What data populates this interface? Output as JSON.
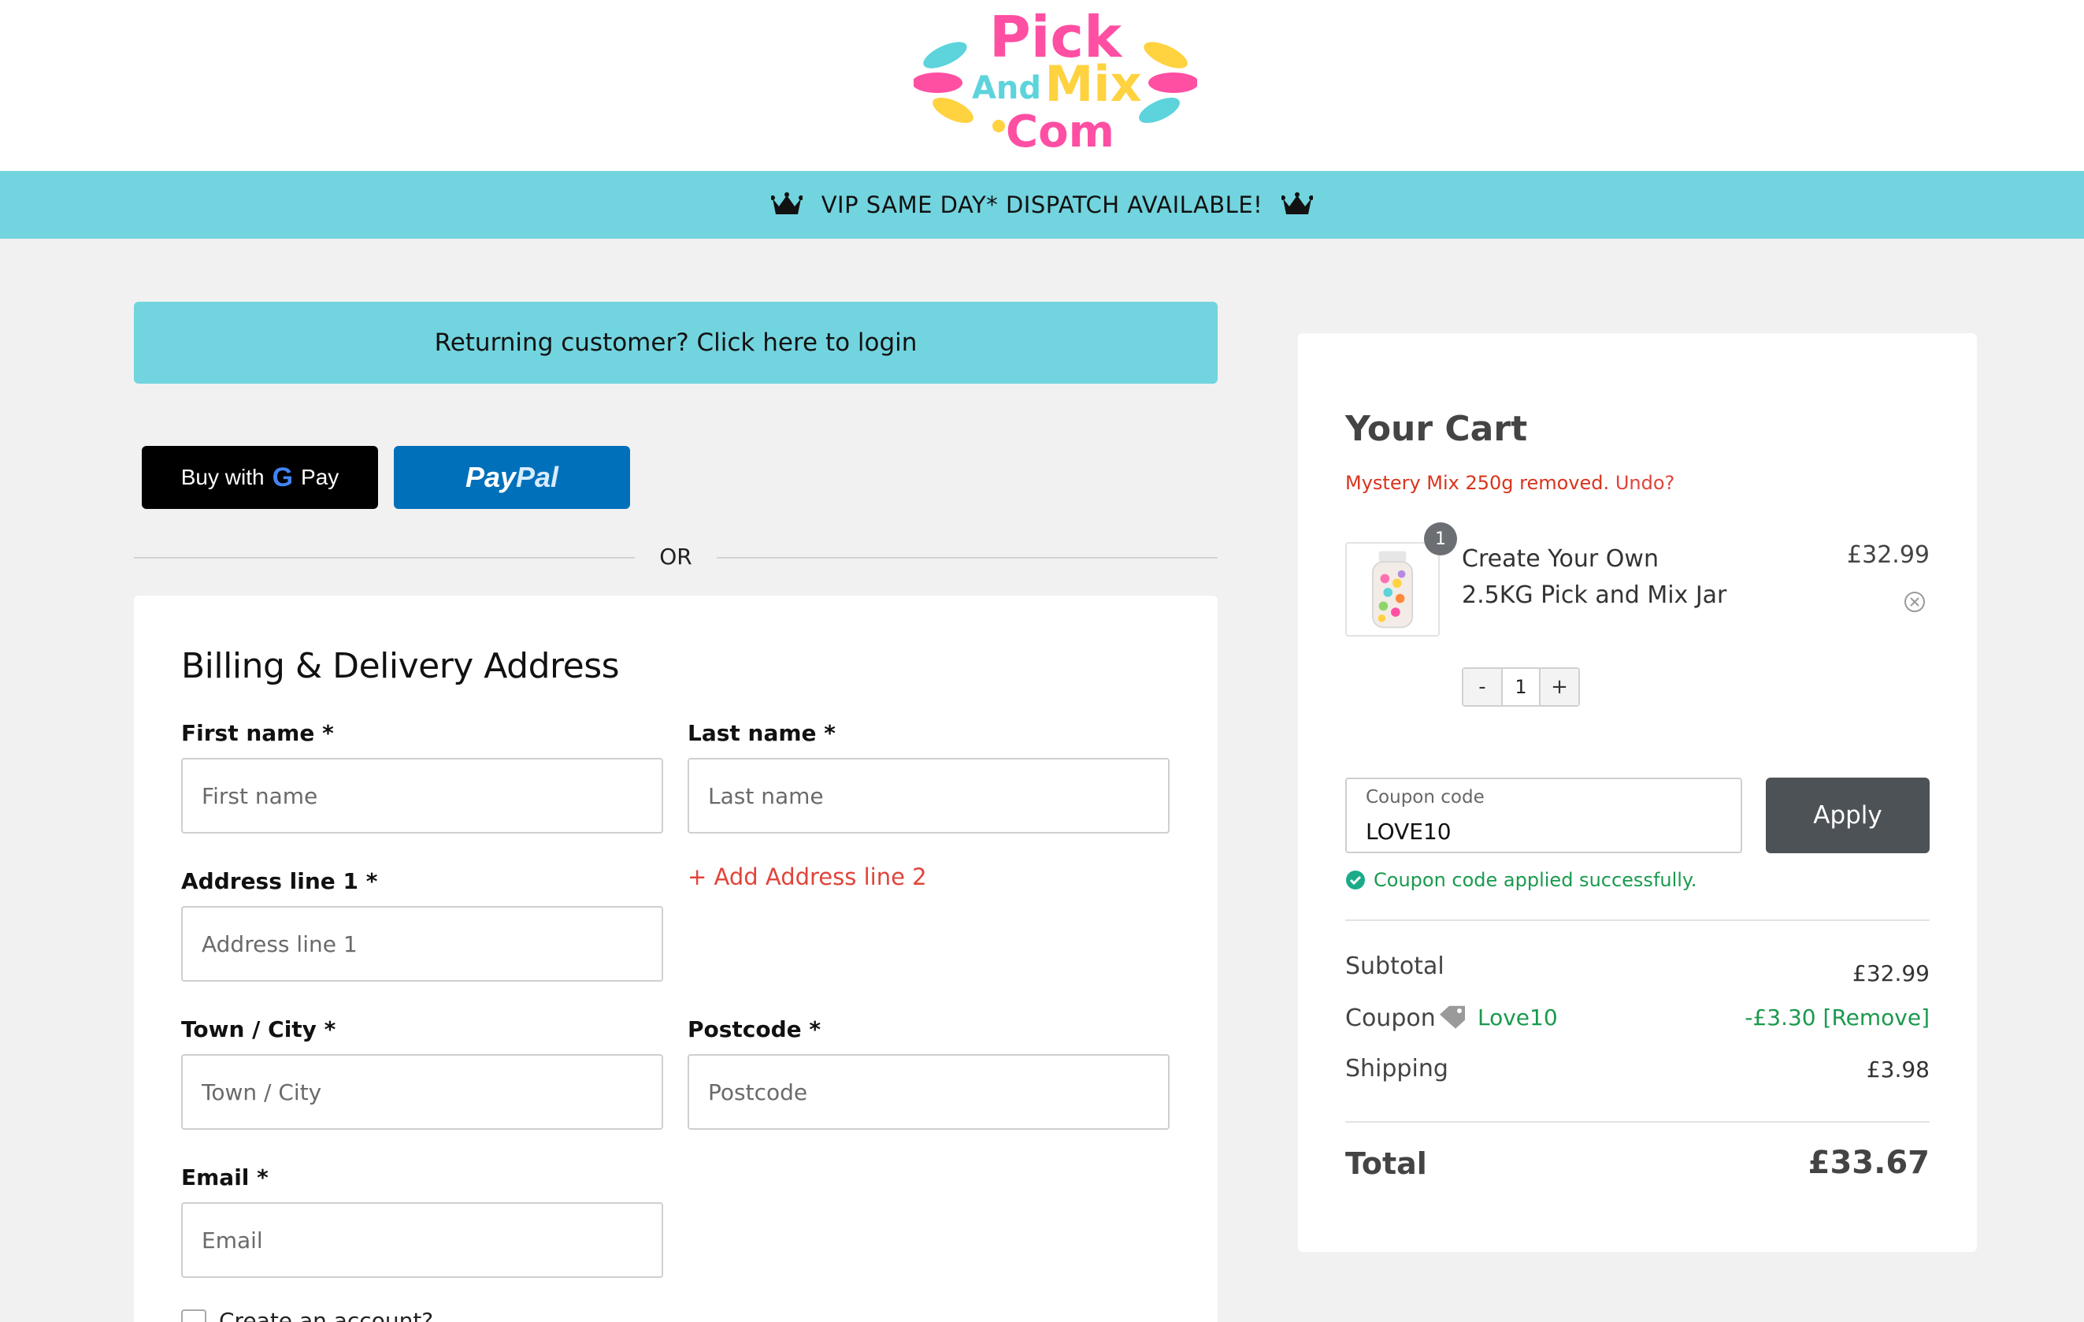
{
  "header": {
    "logo_text": "Pick And Mix .com",
    "vip_banner": "VIP SAME DAY* DISPATCH AVAILABLE!"
  },
  "checkout": {
    "login_prompt": "Returning customer? Click here to login",
    "gpay": {
      "prefix": "Buy with",
      "g": "G",
      "suffix": "Pay"
    },
    "paypal": {
      "pay": "Pay",
      "pal": "Pal"
    },
    "or_text": "OR",
    "billing": {
      "title": "Billing & Delivery Address",
      "first_name": {
        "label": "First name *",
        "placeholder": "First name"
      },
      "last_name": {
        "label": "Last name *",
        "placeholder": "Last name"
      },
      "address1": {
        "label": "Address line 1 *",
        "placeholder": "Address line 1"
      },
      "add_address_line2": "+ Add Address line 2",
      "town": {
        "label": "Town / City *",
        "placeholder": "Town / City"
      },
      "postcode": {
        "label": "Postcode *",
        "placeholder": "Postcode"
      },
      "email": {
        "label": "Email *",
        "placeholder": "Email"
      },
      "create_account": "Create an account?"
    }
  },
  "cart": {
    "title": "Your Cart",
    "removed_notice": "Mystery Mix 250g removed.",
    "undo": "Undo?",
    "item": {
      "quantity_badge": "1",
      "name": "Create Your Own 2.5KG Pick and Mix Jar",
      "price": "£32.99",
      "quantity": "1",
      "minus": "-",
      "plus": "+"
    },
    "coupon": {
      "label": "Coupon code",
      "value": "LOVE10",
      "apply": "Apply",
      "success": "Coupon code applied successfully."
    },
    "subtotal": {
      "label": "Subtotal",
      "value": "£32.99"
    },
    "coupon_line": {
      "label": "Coupon",
      "code": "Love10",
      "value": "-£3.30",
      "remove": "[Remove]"
    },
    "shipping": {
      "label": "Shipping",
      "value": "£3.98"
    },
    "total": {
      "label": "Total",
      "value": "£33.67"
    }
  },
  "colors": {
    "accent_teal": "#72d4df",
    "paypal_blue": "#0070ba",
    "success_green": "#1a9a4e",
    "notice_red": "#d9341c",
    "apply_grey": "#4d5257"
  }
}
